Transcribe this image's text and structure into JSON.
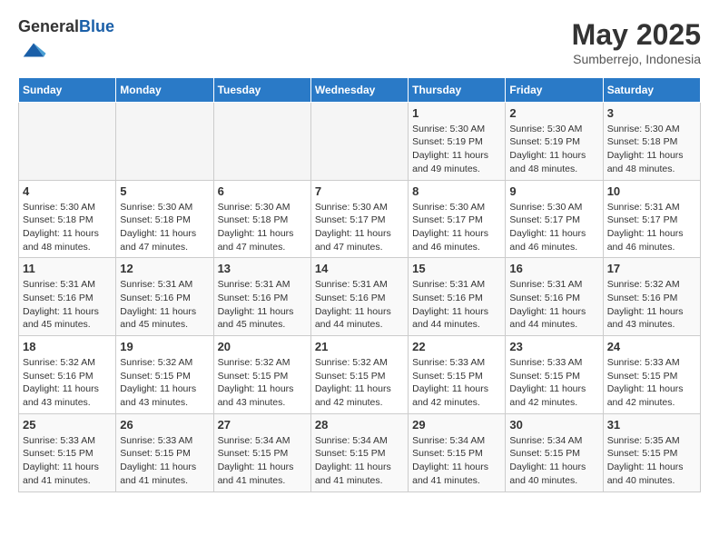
{
  "header": {
    "logo_general": "General",
    "logo_blue": "Blue",
    "month_title": "May 2025",
    "location": "Sumberrejo, Indonesia"
  },
  "weekdays": [
    "Sunday",
    "Monday",
    "Tuesday",
    "Wednesday",
    "Thursday",
    "Friday",
    "Saturday"
  ],
  "weeks": [
    [
      {
        "day": "",
        "sunrise": "",
        "sunset": "",
        "daylight": ""
      },
      {
        "day": "",
        "sunrise": "",
        "sunset": "",
        "daylight": ""
      },
      {
        "day": "",
        "sunrise": "",
        "sunset": "",
        "daylight": ""
      },
      {
        "day": "",
        "sunrise": "",
        "sunset": "",
        "daylight": ""
      },
      {
        "day": "1",
        "sunrise": "Sunrise: 5:30 AM",
        "sunset": "Sunset: 5:19 PM",
        "daylight": "Daylight: 11 hours and 49 minutes."
      },
      {
        "day": "2",
        "sunrise": "Sunrise: 5:30 AM",
        "sunset": "Sunset: 5:19 PM",
        "daylight": "Daylight: 11 hours and 48 minutes."
      },
      {
        "day": "3",
        "sunrise": "Sunrise: 5:30 AM",
        "sunset": "Sunset: 5:18 PM",
        "daylight": "Daylight: 11 hours and 48 minutes."
      }
    ],
    [
      {
        "day": "4",
        "sunrise": "Sunrise: 5:30 AM",
        "sunset": "Sunset: 5:18 PM",
        "daylight": "Daylight: 11 hours and 48 minutes."
      },
      {
        "day": "5",
        "sunrise": "Sunrise: 5:30 AM",
        "sunset": "Sunset: 5:18 PM",
        "daylight": "Daylight: 11 hours and 47 minutes."
      },
      {
        "day": "6",
        "sunrise": "Sunrise: 5:30 AM",
        "sunset": "Sunset: 5:18 PM",
        "daylight": "Daylight: 11 hours and 47 minutes."
      },
      {
        "day": "7",
        "sunrise": "Sunrise: 5:30 AM",
        "sunset": "Sunset: 5:17 PM",
        "daylight": "Daylight: 11 hours and 47 minutes."
      },
      {
        "day": "8",
        "sunrise": "Sunrise: 5:30 AM",
        "sunset": "Sunset: 5:17 PM",
        "daylight": "Daylight: 11 hours and 46 minutes."
      },
      {
        "day": "9",
        "sunrise": "Sunrise: 5:30 AM",
        "sunset": "Sunset: 5:17 PM",
        "daylight": "Daylight: 11 hours and 46 minutes."
      },
      {
        "day": "10",
        "sunrise": "Sunrise: 5:31 AM",
        "sunset": "Sunset: 5:17 PM",
        "daylight": "Daylight: 11 hours and 46 minutes."
      }
    ],
    [
      {
        "day": "11",
        "sunrise": "Sunrise: 5:31 AM",
        "sunset": "Sunset: 5:16 PM",
        "daylight": "Daylight: 11 hours and 45 minutes."
      },
      {
        "day": "12",
        "sunrise": "Sunrise: 5:31 AM",
        "sunset": "Sunset: 5:16 PM",
        "daylight": "Daylight: 11 hours and 45 minutes."
      },
      {
        "day": "13",
        "sunrise": "Sunrise: 5:31 AM",
        "sunset": "Sunset: 5:16 PM",
        "daylight": "Daylight: 11 hours and 45 minutes."
      },
      {
        "day": "14",
        "sunrise": "Sunrise: 5:31 AM",
        "sunset": "Sunset: 5:16 PM",
        "daylight": "Daylight: 11 hours and 44 minutes."
      },
      {
        "day": "15",
        "sunrise": "Sunrise: 5:31 AM",
        "sunset": "Sunset: 5:16 PM",
        "daylight": "Daylight: 11 hours and 44 minutes."
      },
      {
        "day": "16",
        "sunrise": "Sunrise: 5:31 AM",
        "sunset": "Sunset: 5:16 PM",
        "daylight": "Daylight: 11 hours and 44 minutes."
      },
      {
        "day": "17",
        "sunrise": "Sunrise: 5:32 AM",
        "sunset": "Sunset: 5:16 PM",
        "daylight": "Daylight: 11 hours and 43 minutes."
      }
    ],
    [
      {
        "day": "18",
        "sunrise": "Sunrise: 5:32 AM",
        "sunset": "Sunset: 5:16 PM",
        "daylight": "Daylight: 11 hours and 43 minutes."
      },
      {
        "day": "19",
        "sunrise": "Sunrise: 5:32 AM",
        "sunset": "Sunset: 5:15 PM",
        "daylight": "Daylight: 11 hours and 43 minutes."
      },
      {
        "day": "20",
        "sunrise": "Sunrise: 5:32 AM",
        "sunset": "Sunset: 5:15 PM",
        "daylight": "Daylight: 11 hours and 43 minutes."
      },
      {
        "day": "21",
        "sunrise": "Sunrise: 5:32 AM",
        "sunset": "Sunset: 5:15 PM",
        "daylight": "Daylight: 11 hours and 42 minutes."
      },
      {
        "day": "22",
        "sunrise": "Sunrise: 5:33 AM",
        "sunset": "Sunset: 5:15 PM",
        "daylight": "Daylight: 11 hours and 42 minutes."
      },
      {
        "day": "23",
        "sunrise": "Sunrise: 5:33 AM",
        "sunset": "Sunset: 5:15 PM",
        "daylight": "Daylight: 11 hours and 42 minutes."
      },
      {
        "day": "24",
        "sunrise": "Sunrise: 5:33 AM",
        "sunset": "Sunset: 5:15 PM",
        "daylight": "Daylight: 11 hours and 42 minutes."
      }
    ],
    [
      {
        "day": "25",
        "sunrise": "Sunrise: 5:33 AM",
        "sunset": "Sunset: 5:15 PM",
        "daylight": "Daylight: 11 hours and 41 minutes."
      },
      {
        "day": "26",
        "sunrise": "Sunrise: 5:33 AM",
        "sunset": "Sunset: 5:15 PM",
        "daylight": "Daylight: 11 hours and 41 minutes."
      },
      {
        "day": "27",
        "sunrise": "Sunrise: 5:34 AM",
        "sunset": "Sunset: 5:15 PM",
        "daylight": "Daylight: 11 hours and 41 minutes."
      },
      {
        "day": "28",
        "sunrise": "Sunrise: 5:34 AM",
        "sunset": "Sunset: 5:15 PM",
        "daylight": "Daylight: 11 hours and 41 minutes."
      },
      {
        "day": "29",
        "sunrise": "Sunrise: 5:34 AM",
        "sunset": "Sunset: 5:15 PM",
        "daylight": "Daylight: 11 hours and 41 minutes."
      },
      {
        "day": "30",
        "sunrise": "Sunrise: 5:34 AM",
        "sunset": "Sunset: 5:15 PM",
        "daylight": "Daylight: 11 hours and 40 minutes."
      },
      {
        "day": "31",
        "sunrise": "Sunrise: 5:35 AM",
        "sunset": "Sunset: 5:15 PM",
        "daylight": "Daylight: 11 hours and 40 minutes."
      }
    ]
  ]
}
